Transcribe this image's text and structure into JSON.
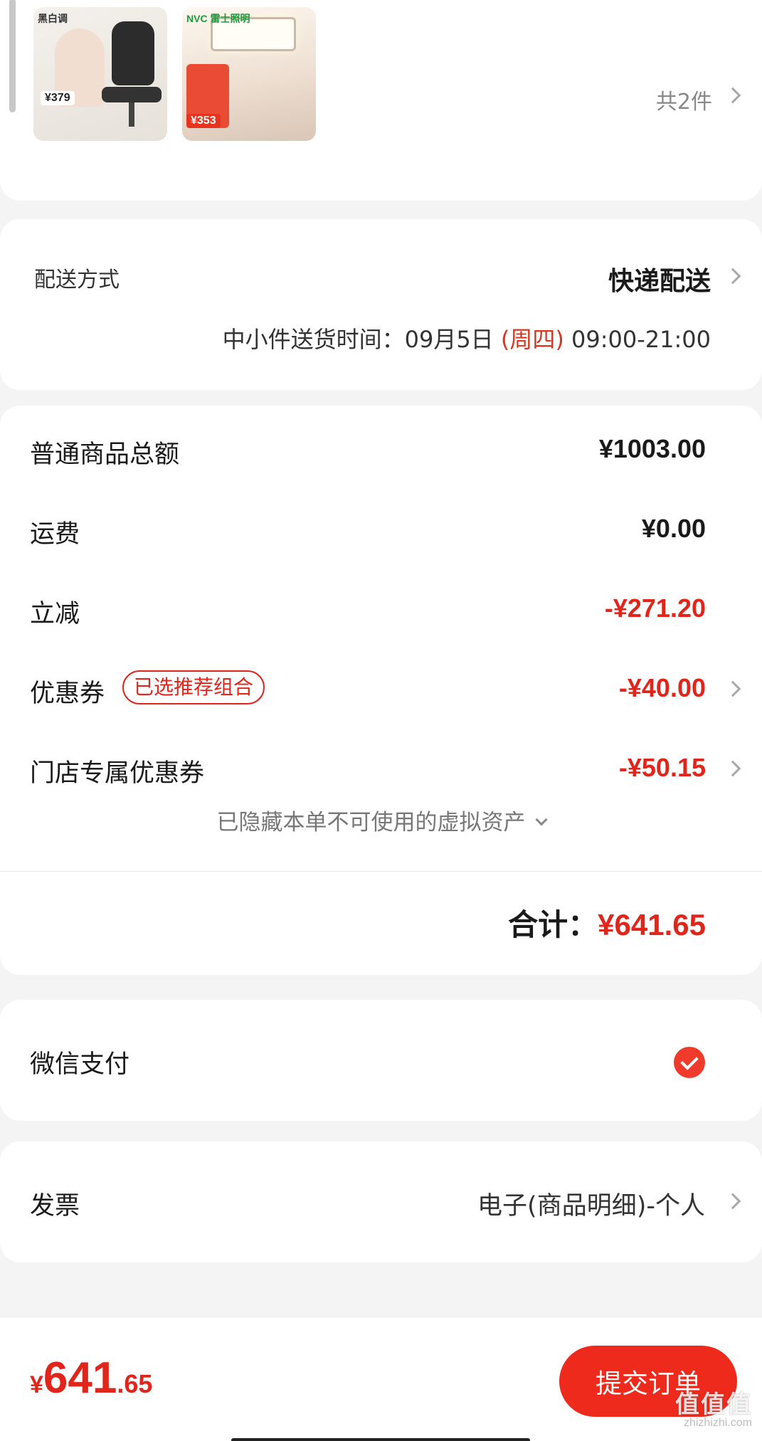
{
  "products": {
    "items": [
      {
        "brand": "黑白调",
        "price": "¥379",
        "icon": "office-chair"
      },
      {
        "brand": "NVC 雷士照明",
        "price": "¥353",
        "icon": "ceiling-lamp"
      }
    ],
    "count_label": "共2件"
  },
  "delivery": {
    "label": "配送方式",
    "method": "快递配送",
    "time_prefix": "中小件送货时间：09月5日 ",
    "weekday": "(周四)",
    "time_suffix": " 09:00-21:00"
  },
  "totals": {
    "rows": [
      {
        "label": "普通商品总额",
        "value": "¥1003.00"
      },
      {
        "label": "运费",
        "value": "¥0.00"
      },
      {
        "label": "立减",
        "value": "-¥271.20"
      },
      {
        "label": "优惠券",
        "badge": "已选推荐组合",
        "value": "-¥40.00"
      },
      {
        "label": "门店专属优惠券",
        "value": "-¥50.15"
      }
    ],
    "hidden_assets": "已隐藏本单不可使用的虚拟资产",
    "total_label": "合计：",
    "total_value": "¥641.65"
  },
  "payment": {
    "label": "微信支付",
    "selected": true
  },
  "invoice": {
    "label": "发票",
    "value": "电子(商品明细)-个人"
  },
  "bottom_bar": {
    "price_symbol": "¥",
    "price_int": "641",
    "price_dec": ".65",
    "submit_label": "提交订单",
    "watermark": "值值值",
    "watermark_sub": "zhizhizhi.com"
  },
  "colors": {
    "accent_red": "#e1251b",
    "button_red": "#ee2a1c",
    "background": "#f4f4f4"
  }
}
